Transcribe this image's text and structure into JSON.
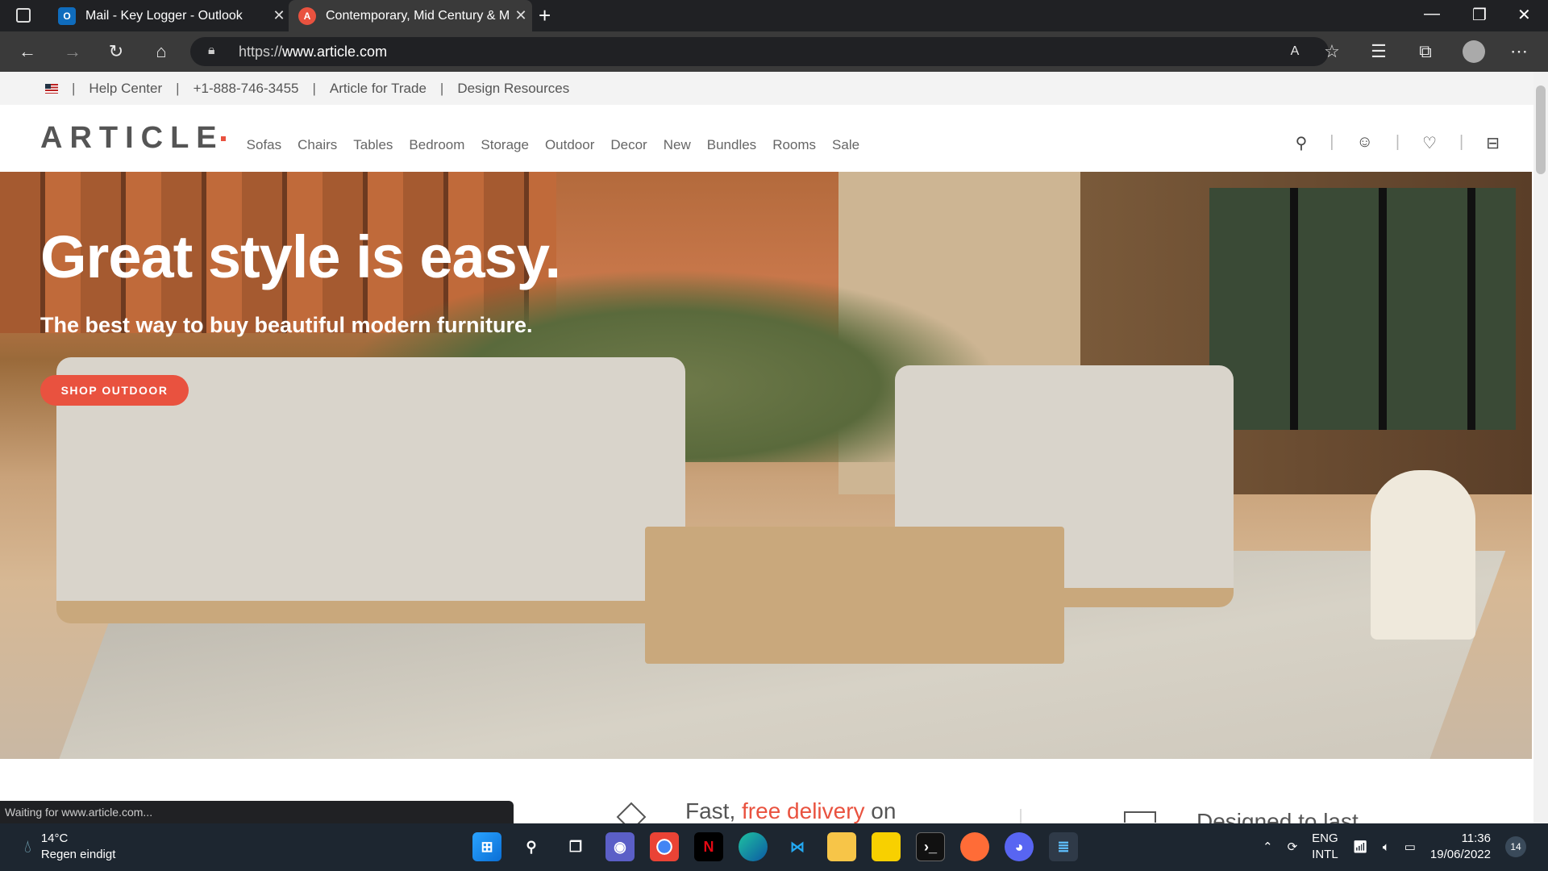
{
  "browser": {
    "tabs": [
      {
        "label": "Mail - Key Logger - Outlook",
        "icon": "outlook-icon"
      },
      {
        "label": "Contemporary, Mid Century & M",
        "icon": "article-favicon-icon"
      }
    ],
    "new_tab": "+",
    "url_scheme": "https://",
    "url_host": "www.article.com",
    "status_text": "Waiting for www.article.com..."
  },
  "utility": {
    "help": "Help Center",
    "phone": "+1-888-746-3455",
    "trade": "Article for Trade",
    "design": "Design Resources"
  },
  "nav": {
    "logo": "ARTICLE",
    "items": [
      "Sofas",
      "Chairs",
      "Tables",
      "Bedroom",
      "Storage",
      "Outdoor",
      "Decor",
      "New",
      "Bundles",
      "Rooms",
      "Sale"
    ]
  },
  "hero": {
    "title": "Great style is easy.",
    "subtitle": "The best way to buy beautiful modern furniture.",
    "cta": "SHOP OUTDOOR"
  },
  "features": {
    "f1_pre": "Fast, ",
    "f1_accent": "free delivery",
    "f1_post": " on",
    "f2": "Designed to last"
  },
  "taskbar": {
    "temp": "14°C",
    "weather": "Regen eindigt",
    "lang1": "ENG",
    "lang2": "INTL",
    "time": "11:36",
    "date": "19/06/2022",
    "notifications": "14"
  },
  "colors": {
    "accent": "#e9523f",
    "chrome": "#202124",
    "taskbar": "#1d2630"
  }
}
